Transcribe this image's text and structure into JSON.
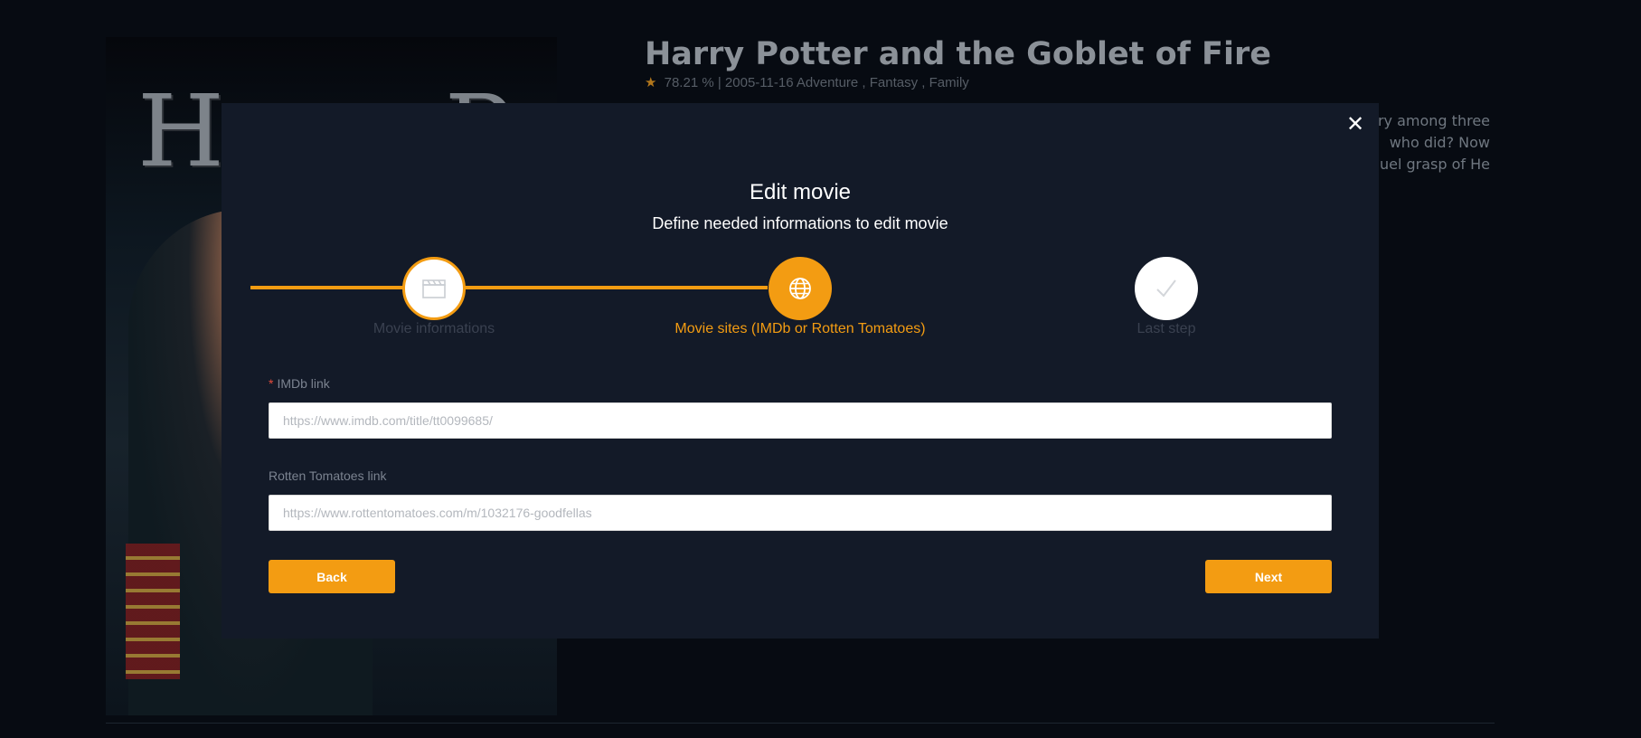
{
  "background": {
    "movie_title": "Harry Potter and the Goblet of Fire",
    "rating": "78.21 %",
    "separator": "|",
    "release_date": "2005-11-16",
    "genres": "Adventure , Fantasy , Family",
    "overview_lines": [
      "ory among three",
      "who did? Now",
      "uel grasp of He"
    ],
    "poster_title": "Harry Potter"
  },
  "modal": {
    "title": "Edit movie",
    "subtitle": "Define needed informations to edit movie",
    "close_label": "✕",
    "steps": [
      {
        "label": "Movie informations"
      },
      {
        "label": "Movie sites (IMDb or Rotten Tomatoes)"
      },
      {
        "label": "Last step"
      }
    ],
    "active_step": 2,
    "fields": {
      "imdb": {
        "required_mark": "*",
        "label": "IMDb link",
        "placeholder": "https://www.imdb.com/title/tt0099685/",
        "value": ""
      },
      "rotten": {
        "label": "Rotten Tomatoes link",
        "placeholder": "https://www.rottentomatoes.com/m/1032176-goodfellas",
        "value": ""
      }
    },
    "buttons": {
      "back_label": "Back",
      "next_label": "Next"
    }
  },
  "icons": {
    "step1": "clapperboard-icon",
    "step2": "globe-icon",
    "step3": "check-icon",
    "rating": "star-icon"
  },
  "colors": {
    "accent": "#f39c12",
    "modal_bg": "#131a28",
    "page_bg": "#070b12"
  }
}
